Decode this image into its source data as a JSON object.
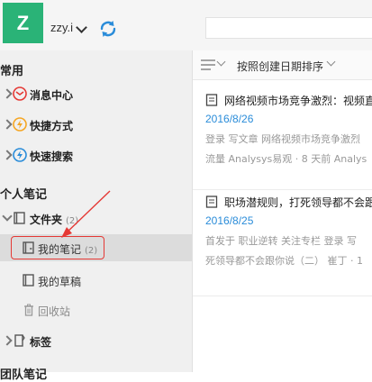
{
  "header": {
    "avatar_letter": "Z",
    "username": "zzy.i"
  },
  "sidebar": {
    "section_common": "常用",
    "items_common": [
      {
        "label": "消息中心"
      },
      {
        "label": "快捷方式"
      },
      {
        "label": "快速搜索"
      }
    ],
    "section_personal": "个人笔记",
    "folder": {
      "label": "文件夹",
      "count": "(2)"
    },
    "my_notes": {
      "label": "我的笔记",
      "count": "(2)"
    },
    "drafts": {
      "label": "我的草稿"
    },
    "trash": {
      "label": "回收站"
    },
    "tags": {
      "label": "标签"
    },
    "section_team": "团队笔记"
  },
  "main": {
    "sort_label": "按照创建日期排序",
    "notes": [
      {
        "title": "网络视频市场竞争激烈：视频直",
        "date": "2016/8/26",
        "snippet_line1": "登录 写文章 网络视频市场竞争激烈",
        "snippet_line2": "流量 Analysys易观 · 8 天前 Analys"
      },
      {
        "title": "职场潜规则，打死领导都不会跟",
        "date": "2016/8/25",
        "snippet_line1": "首发于 职业逆转 关注专栏 登录 写",
        "snippet_line2": "死领导都不会跟你说（二） 崔丁 · 1"
      }
    ]
  },
  "colors": {
    "avatar": "#2ab377",
    "accent_blue": "#2a8cd9",
    "highlight_red": "#e53935",
    "message_icon": "#e53935",
    "shortcut_icon": "#f5a623",
    "search_icon": "#2a8cd9"
  },
  "icons": [
    "sync-icon",
    "mail-icon",
    "lightning-icon",
    "quick-search-icon",
    "folder-icon",
    "note-icon",
    "draft-icon",
    "trash-icon",
    "tag-icon",
    "list-icon",
    "document-icon"
  ]
}
